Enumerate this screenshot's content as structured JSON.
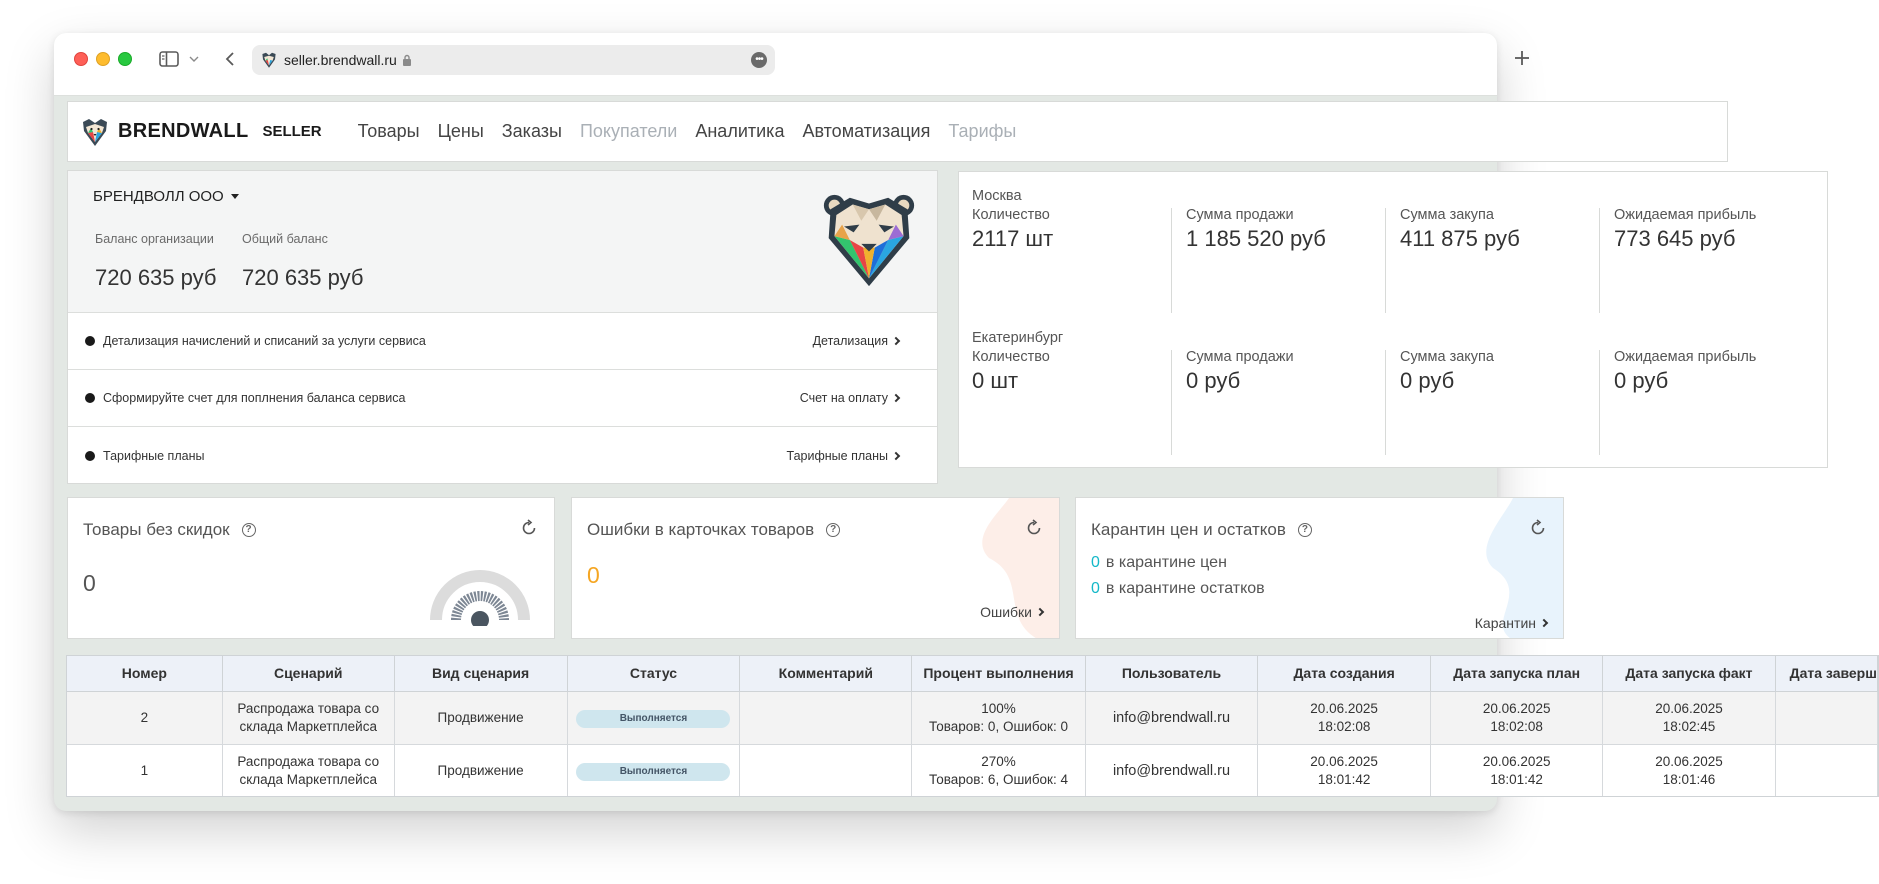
{
  "browser": {
    "url": "seller.brendwall.ru",
    "more_glyph": "•••"
  },
  "app": {
    "brand_name": "BRENDWALL",
    "brand_seller": "SELLER",
    "nav": [
      {
        "label": "Товары",
        "enabled": true
      },
      {
        "label": "Цены",
        "enabled": true
      },
      {
        "label": "Заказы",
        "enabled": true
      },
      {
        "label": "Покупатели",
        "enabled": false
      },
      {
        "label": "Аналитика",
        "enabled": true
      },
      {
        "label": "Автоматизация",
        "enabled": true
      },
      {
        "label": "Тарифы",
        "enabled": false
      }
    ]
  },
  "balance": {
    "org_name": "БРЕНДВОЛЛ ООО",
    "org_balance_label": "Баланс организации",
    "org_balance_value": "720 635 руб",
    "total_balance_label": "Общий баланс",
    "total_balance_value": "720 635 руб",
    "rows": [
      {
        "text": "Детализация начислений и списаний за услуги сервиса",
        "link": "Детализация"
      },
      {
        "text": "Сформируйте счет для поплнения баланса сервиса",
        "link": "Счет на оплату"
      },
      {
        "text": "Тарифные планы",
        "link": "Тарифные планы"
      }
    ]
  },
  "stats": {
    "cities": [
      {
        "name": "Москва",
        "items": [
          {
            "label": "Количество",
            "value": "2117 шт"
          },
          {
            "label": "Сумма продажи",
            "value": "1 185 520 руб"
          },
          {
            "label": "Сумма закупа",
            "value": "411 875 руб"
          },
          {
            "label": "Ожидаемая прибыль",
            "value": "773 645 руб"
          }
        ]
      },
      {
        "name": "Екатеринбург",
        "items": [
          {
            "label": "Количество",
            "value": "0 шт"
          },
          {
            "label": "Сумма продажи",
            "value": "0 руб"
          },
          {
            "label": "Сумма закупа",
            "value": "0 руб"
          },
          {
            "label": "Ожидаемая прибыль",
            "value": "0 руб"
          }
        ]
      }
    ]
  },
  "widgets": {
    "no_discount": {
      "title": "Товары без скидок",
      "value": "0"
    },
    "errors": {
      "title": "Ошибки в карточках товаров",
      "value": "0",
      "link": "Ошибки",
      "value_color": "#f5a623"
    },
    "quarantine": {
      "title": "Карантин цен и остатков",
      "prices_count": "0",
      "prices_text": "в карантине цен",
      "stock_count": "0",
      "stock_text": "в карантине остатков",
      "link": "Карантин"
    },
    "help_glyph": "?"
  },
  "table": {
    "columns": [
      "Номер",
      "Сценарий",
      "Вид сценария",
      "Статус",
      "Комментарий",
      "Процент выполнения",
      "Пользователь",
      "Дата создания",
      "Дата запуска план",
      "Дата запуска факт",
      "Дата заверш"
    ],
    "rows": [
      {
        "number": "2",
        "scenario": "Распродажа товара со склада Маркетплейса",
        "kind": "Продвижение",
        "status": "Выполняется",
        "comment": "",
        "percent": "100%",
        "percent_detail": "Товаров: 0, Ошибок: 0",
        "user": "info@brendwall.ru",
        "created_date": "20.06.2025",
        "created_time": "18:02:08",
        "plan_date": "20.06.2025",
        "plan_time": "18:02:08",
        "fact_date": "20.06.2025",
        "fact_time": "18:02:45",
        "end": ""
      },
      {
        "number": "1",
        "scenario": "Распродажа товара со склада Маркетплейса",
        "kind": "Продвижение",
        "status": "Выполняется",
        "comment": "",
        "percent": "270%",
        "percent_detail": "Товаров: 6, Ошибок: 4",
        "user": "info@brendwall.ru",
        "created_date": "20.06.2025",
        "created_time": "18:01:42",
        "plan_date": "20.06.2025",
        "plan_time": "18:01:42",
        "fact_date": "20.06.2025",
        "fact_time": "18:01:46",
        "end": ""
      }
    ]
  },
  "colors": {
    "accent_teal": "#14b8c8",
    "warning_orange": "#f5a623",
    "status_pill_bg": "#cfe6ee"
  },
  "icons": [
    "sidebar-toggle-icon",
    "chevron-down-icon",
    "back-icon",
    "lock-icon",
    "more-icon",
    "new-tab-icon",
    "bear-logo-icon",
    "help-icon",
    "refresh-icon",
    "chevron-right-icon",
    "gauge-icon"
  ]
}
